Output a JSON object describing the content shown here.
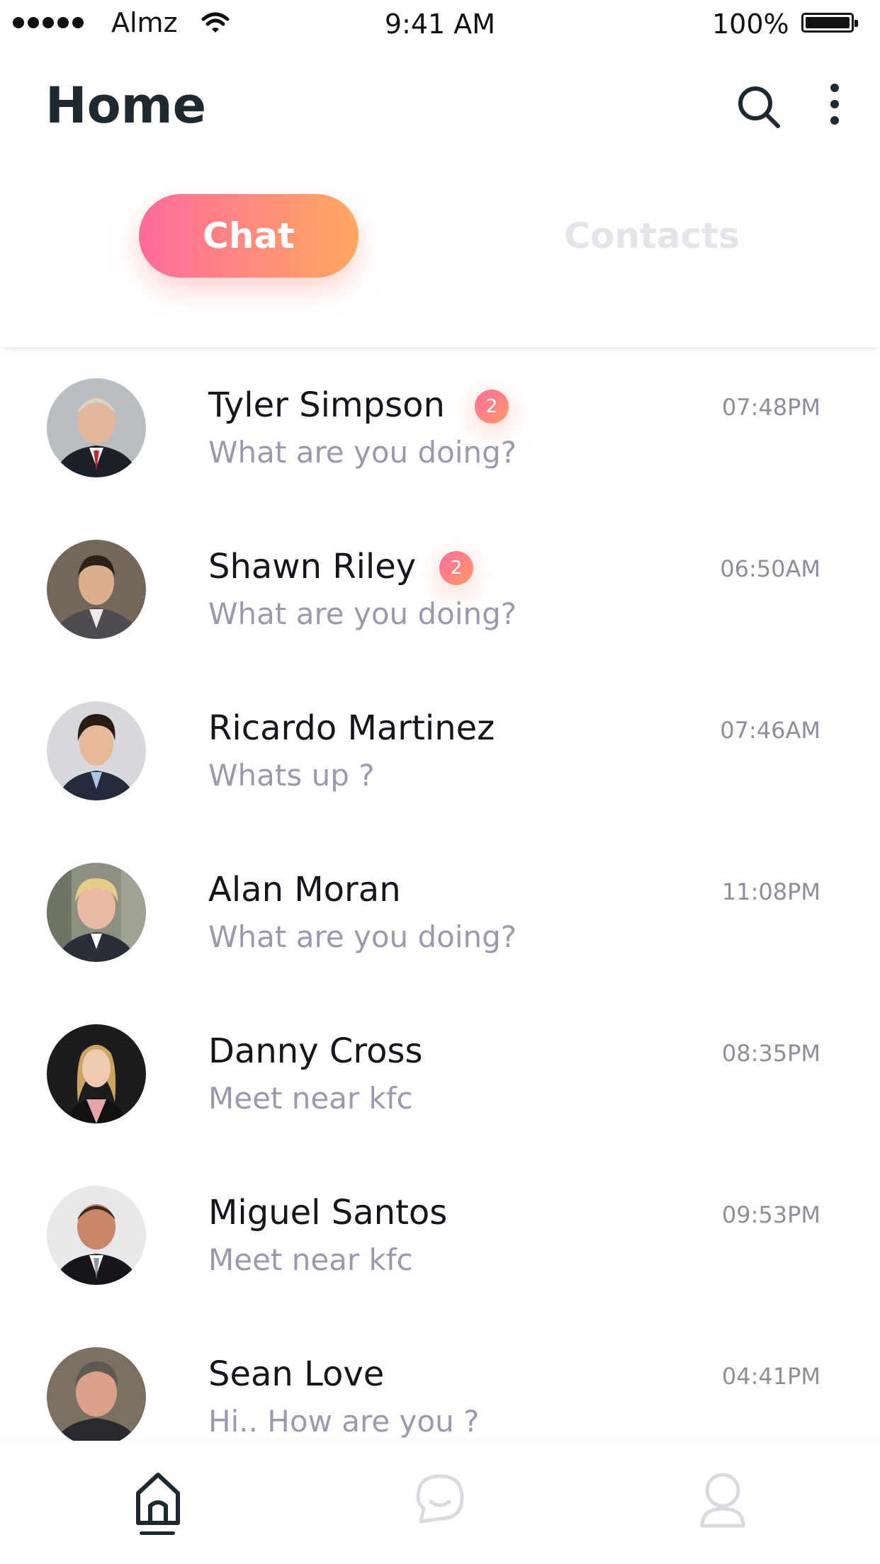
{
  "status_bar": {
    "carrier": "Almz",
    "time": "9:41 AM",
    "battery": "100%"
  },
  "header": {
    "title": "Home",
    "icons": [
      "search-icon",
      "more-vertical-icon"
    ]
  },
  "tabs": {
    "chat": "Chat",
    "contacts": "Contacts",
    "active": "chat",
    "accent_gradient": [
      "#ff6b9d",
      "#ffa860"
    ]
  },
  "chats": [
    {
      "name": "Tyler Simpson",
      "message": "What are you doing?",
      "time": "07:48PM",
      "unread": "2"
    },
    {
      "name": "Shawn Riley",
      "message": "What are you doing?",
      "time": "06:50AM",
      "unread": "2"
    },
    {
      "name": "Ricardo Martinez",
      "message": "Whats up ?",
      "time": "07:46AM"
    },
    {
      "name": "Alan Moran",
      "message": "What are you doing?",
      "time": "11:08PM"
    },
    {
      "name": "Danny Cross",
      "message": "Meet near kfc",
      "time": "08:35PM"
    },
    {
      "name": "Miguel Santos",
      "message": "Meet near kfc",
      "time": "09:53PM"
    },
    {
      "name": "Sean Love",
      "message": "Hi.. How are you ?",
      "time": "04:41PM"
    }
  ],
  "bottom_nav": {
    "items": [
      "home-icon",
      "chat-bubble-icon",
      "profile-icon"
    ],
    "active": "home-icon"
  }
}
